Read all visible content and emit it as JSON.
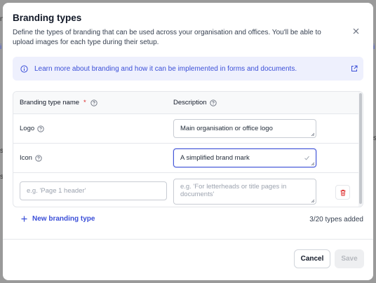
{
  "modal": {
    "title": "Branding types",
    "description": "Define the types of branding that can be used across your organisation and offices. You'll be able to upload images for each type during their setup."
  },
  "info_banner": {
    "text": "Learn more about branding and how it can be implemented in forms and documents.",
    "icon": "info-icon",
    "link_icon": "external-link-icon"
  },
  "table": {
    "headers": {
      "name": "Branding type name",
      "required_marker": "*",
      "description": "Description"
    },
    "rows": [
      {
        "name": "Logo",
        "description": "Main organisation or office logo"
      },
      {
        "name": "Icon",
        "description": "A simplified brand mark"
      }
    ],
    "new_row": {
      "name_placeholder": "e.g. 'Page 1 header'",
      "description_placeholder": "e.g. 'For letterheads or title pages in documents'"
    }
  },
  "actions": {
    "add_label": "New branding type",
    "count": "3/20 types added",
    "cancel": "Cancel",
    "save": "Save"
  },
  "colors": {
    "accent": "#3b4fd8",
    "banner_bg": "#eef0fd",
    "danger": "#dc2626"
  }
}
